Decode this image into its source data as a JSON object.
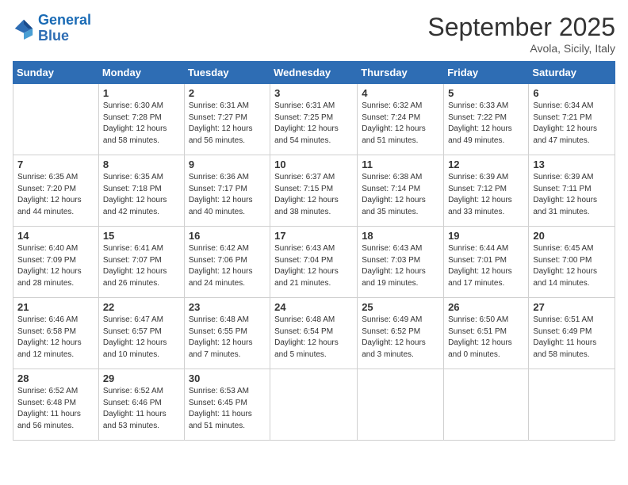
{
  "header": {
    "logo_line1": "General",
    "logo_line2": "Blue",
    "month": "September 2025",
    "location": "Avola, Sicily, Italy"
  },
  "days_of_week": [
    "Sunday",
    "Monday",
    "Tuesday",
    "Wednesday",
    "Thursday",
    "Friday",
    "Saturday"
  ],
  "weeks": [
    [
      {
        "num": "",
        "info": ""
      },
      {
        "num": "1",
        "info": "Sunrise: 6:30 AM\nSunset: 7:28 PM\nDaylight: 12 hours\nand 58 minutes."
      },
      {
        "num": "2",
        "info": "Sunrise: 6:31 AM\nSunset: 7:27 PM\nDaylight: 12 hours\nand 56 minutes."
      },
      {
        "num": "3",
        "info": "Sunrise: 6:31 AM\nSunset: 7:25 PM\nDaylight: 12 hours\nand 54 minutes."
      },
      {
        "num": "4",
        "info": "Sunrise: 6:32 AM\nSunset: 7:24 PM\nDaylight: 12 hours\nand 51 minutes."
      },
      {
        "num": "5",
        "info": "Sunrise: 6:33 AM\nSunset: 7:22 PM\nDaylight: 12 hours\nand 49 minutes."
      },
      {
        "num": "6",
        "info": "Sunrise: 6:34 AM\nSunset: 7:21 PM\nDaylight: 12 hours\nand 47 minutes."
      }
    ],
    [
      {
        "num": "7",
        "info": "Sunrise: 6:35 AM\nSunset: 7:20 PM\nDaylight: 12 hours\nand 44 minutes."
      },
      {
        "num": "8",
        "info": "Sunrise: 6:35 AM\nSunset: 7:18 PM\nDaylight: 12 hours\nand 42 minutes."
      },
      {
        "num": "9",
        "info": "Sunrise: 6:36 AM\nSunset: 7:17 PM\nDaylight: 12 hours\nand 40 minutes."
      },
      {
        "num": "10",
        "info": "Sunrise: 6:37 AM\nSunset: 7:15 PM\nDaylight: 12 hours\nand 38 minutes."
      },
      {
        "num": "11",
        "info": "Sunrise: 6:38 AM\nSunset: 7:14 PM\nDaylight: 12 hours\nand 35 minutes."
      },
      {
        "num": "12",
        "info": "Sunrise: 6:39 AM\nSunset: 7:12 PM\nDaylight: 12 hours\nand 33 minutes."
      },
      {
        "num": "13",
        "info": "Sunrise: 6:39 AM\nSunset: 7:11 PM\nDaylight: 12 hours\nand 31 minutes."
      }
    ],
    [
      {
        "num": "14",
        "info": "Sunrise: 6:40 AM\nSunset: 7:09 PM\nDaylight: 12 hours\nand 28 minutes."
      },
      {
        "num": "15",
        "info": "Sunrise: 6:41 AM\nSunset: 7:07 PM\nDaylight: 12 hours\nand 26 minutes."
      },
      {
        "num": "16",
        "info": "Sunrise: 6:42 AM\nSunset: 7:06 PM\nDaylight: 12 hours\nand 24 minutes."
      },
      {
        "num": "17",
        "info": "Sunrise: 6:43 AM\nSunset: 7:04 PM\nDaylight: 12 hours\nand 21 minutes."
      },
      {
        "num": "18",
        "info": "Sunrise: 6:43 AM\nSunset: 7:03 PM\nDaylight: 12 hours\nand 19 minutes."
      },
      {
        "num": "19",
        "info": "Sunrise: 6:44 AM\nSunset: 7:01 PM\nDaylight: 12 hours\nand 17 minutes."
      },
      {
        "num": "20",
        "info": "Sunrise: 6:45 AM\nSunset: 7:00 PM\nDaylight: 12 hours\nand 14 minutes."
      }
    ],
    [
      {
        "num": "21",
        "info": "Sunrise: 6:46 AM\nSunset: 6:58 PM\nDaylight: 12 hours\nand 12 minutes."
      },
      {
        "num": "22",
        "info": "Sunrise: 6:47 AM\nSunset: 6:57 PM\nDaylight: 12 hours\nand 10 minutes."
      },
      {
        "num": "23",
        "info": "Sunrise: 6:48 AM\nSunset: 6:55 PM\nDaylight: 12 hours\nand 7 minutes."
      },
      {
        "num": "24",
        "info": "Sunrise: 6:48 AM\nSunset: 6:54 PM\nDaylight: 12 hours\nand 5 minutes."
      },
      {
        "num": "25",
        "info": "Sunrise: 6:49 AM\nSunset: 6:52 PM\nDaylight: 12 hours\nand 3 minutes."
      },
      {
        "num": "26",
        "info": "Sunrise: 6:50 AM\nSunset: 6:51 PM\nDaylight: 12 hours\nand 0 minutes."
      },
      {
        "num": "27",
        "info": "Sunrise: 6:51 AM\nSunset: 6:49 PM\nDaylight: 11 hours\nand 58 minutes."
      }
    ],
    [
      {
        "num": "28",
        "info": "Sunrise: 6:52 AM\nSunset: 6:48 PM\nDaylight: 11 hours\nand 56 minutes."
      },
      {
        "num": "29",
        "info": "Sunrise: 6:52 AM\nSunset: 6:46 PM\nDaylight: 11 hours\nand 53 minutes."
      },
      {
        "num": "30",
        "info": "Sunrise: 6:53 AM\nSunset: 6:45 PM\nDaylight: 11 hours\nand 51 minutes."
      },
      {
        "num": "",
        "info": ""
      },
      {
        "num": "",
        "info": ""
      },
      {
        "num": "",
        "info": ""
      },
      {
        "num": "",
        "info": ""
      }
    ]
  ]
}
